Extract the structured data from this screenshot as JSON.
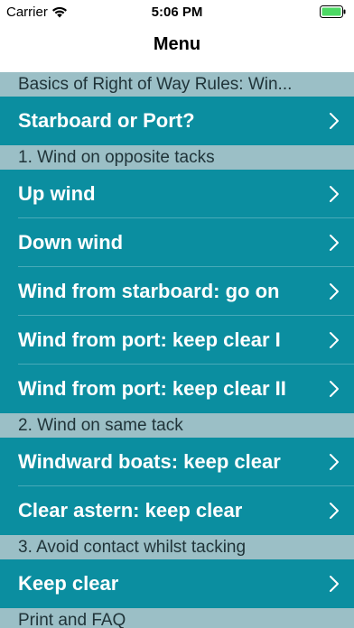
{
  "status": {
    "carrier": "Carrier",
    "time": "5:06 PM"
  },
  "nav": {
    "title": "Menu"
  },
  "sections": [
    {
      "header": "Basics of Right of Way Rules: Win...",
      "items": [
        "Starboard or Port?"
      ]
    },
    {
      "header": "1. Wind on opposite tacks",
      "items": [
        "Up wind",
        "Down wind",
        "Wind from starboard: go on",
        "Wind from port: keep clear I",
        "Wind from port: keep clear II"
      ]
    },
    {
      "header": "2. Wind on same tack",
      "items": [
        "Windward boats: keep clear",
        "Clear astern: keep clear"
      ]
    },
    {
      "header": "3. Avoid contact whilst tacking",
      "items": [
        "Keep clear"
      ]
    },
    {
      "header": "Print and FAQ",
      "items": []
    }
  ],
  "colors": {
    "accent": "#0b8ea0",
    "section": "#9bbfc6",
    "battery": "#4cd964"
  }
}
